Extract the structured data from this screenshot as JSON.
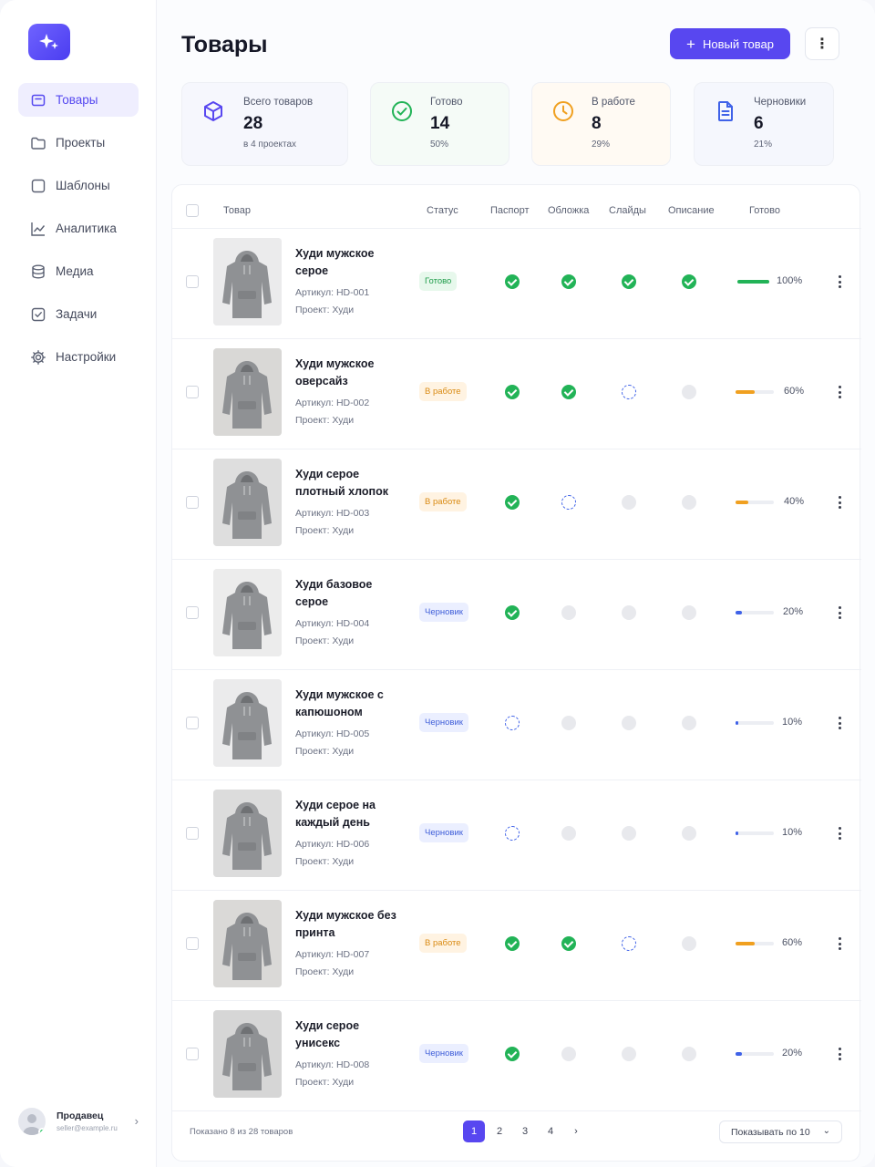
{
  "sidebar": {
    "items": [
      {
        "label": "Товары",
        "icon": "box-icon",
        "active": true
      },
      {
        "label": "Проекты",
        "icon": "folder-icon"
      },
      {
        "label": "Шаблоны",
        "icon": "square-icon"
      },
      {
        "label": "Аналитика",
        "icon": "chart-line-icon"
      },
      {
        "label": "Медиа",
        "icon": "database-icon"
      },
      {
        "label": "Задачи",
        "icon": "checkbox-icon"
      },
      {
        "label": "Настройки",
        "icon": "gear-icon"
      }
    ],
    "user": {
      "name": "Продавец",
      "email": "seller@example.ru"
    }
  },
  "header": {
    "title": "Товары",
    "new_button": "Новый товар"
  },
  "stats": [
    {
      "label": "Всего товаров",
      "value": "28",
      "sub": "в 4 проектах",
      "color": "#5847f0"
    },
    {
      "label": "Готово",
      "value": "14",
      "sub": "50%",
      "color": "#22b357"
    },
    {
      "label": "В работе",
      "value": "8",
      "sub": "29%",
      "color": "#f0a020"
    },
    {
      "label": "Черновики",
      "value": "6",
      "sub": "21%",
      "color": "#3f62e8"
    }
  ],
  "table": {
    "columns": [
      "Товар",
      "Статус",
      "Паспорт",
      "Обложка",
      "Слайды",
      "Описание",
      "Готово"
    ],
    "rows": [
      {
        "name": "Худи мужское серое",
        "sku": "Артикул: HD-001",
        "project": "Проект: Худи",
        "status": "Готово",
        "status_type": "done",
        "checks": [
          "done",
          "done",
          "done",
          "done"
        ],
        "progress": "100%",
        "progress_value": 100
      },
      {
        "name": "Худи мужское оверсайз",
        "sku": "Артикул: HD-002",
        "project": "Проект: Худи",
        "status": "В работе",
        "status_type": "work",
        "checks": [
          "done",
          "done",
          "pend",
          "empty"
        ],
        "progress": "60%",
        "progress_value": 60
      },
      {
        "name": "Худи серое плотный хлопок",
        "sku": "Артикул: HD-003",
        "project": "Проект: Худи",
        "status": "В работе",
        "status_type": "work",
        "checks": [
          "done",
          "pend",
          "empty",
          "empty"
        ],
        "progress": "40%",
        "progress_value": 40
      },
      {
        "name": "Худи базовое серое",
        "sku": "Артикул: HD-004",
        "project": "Проект: Худи",
        "status": "Черновик",
        "status_type": "draft",
        "checks": [
          "done",
          "empty",
          "empty",
          "empty"
        ],
        "progress": "20%",
        "progress_value": 20
      },
      {
        "name": "Худи мужское с капюшоном",
        "sku": "Артикул: HD-005",
        "project": "Проект: Худи",
        "status": "Черновик",
        "status_type": "draft",
        "checks": [
          "pend",
          "empty",
          "empty",
          "empty"
        ],
        "progress": "10%",
        "progress_value": 10
      },
      {
        "name": "Худи серое на каждый день",
        "sku": "Артикул: HD-006",
        "project": "Проект: Худи",
        "status": "Черновик",
        "status_type": "draft",
        "checks": [
          "pend",
          "empty",
          "empty",
          "empty"
        ],
        "progress": "10%",
        "progress_value": 10
      },
      {
        "name": "Худи мужское без принта",
        "sku": "Артикул: HD-007",
        "project": "Проект: Худи",
        "status": "В работе",
        "status_type": "work",
        "checks": [
          "done",
          "done",
          "pend",
          "empty"
        ],
        "progress": "60%",
        "progress_value": 60
      },
      {
        "name": "Худи серое унисекс",
        "sku": "Артикул: HD-008",
        "project": "Проект: Худи",
        "status": "Черновик",
        "status_type": "draft",
        "checks": [
          "done",
          "empty",
          "empty",
          "empty"
        ],
        "progress": "20%",
        "progress_value": 20
      }
    ]
  },
  "footer": {
    "shown": "Показано 8 из 28 товаров",
    "pages": [
      "1",
      "2",
      "3",
      "4"
    ],
    "current_page": "1",
    "per_page": "Показывать по 10"
  },
  "colors": {
    "accent": "#5847f0",
    "done": "#22b357",
    "work": "#f0a020",
    "draft": "#3f62e8"
  }
}
